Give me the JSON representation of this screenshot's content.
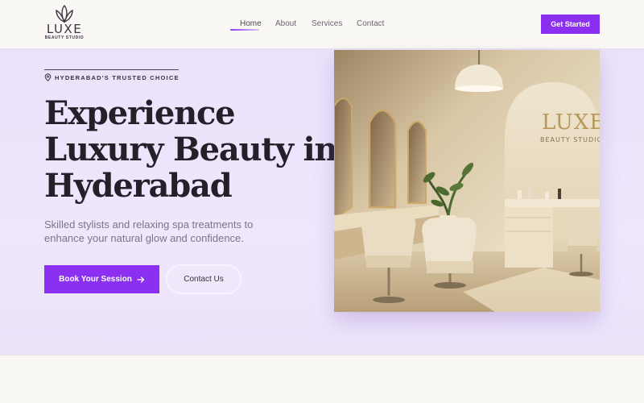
{
  "header": {
    "logo_word": "LUXE",
    "logo_sub": "BEAUTY STUDIO",
    "nav": [
      {
        "label": "Home",
        "active": true
      },
      {
        "label": "About"
      },
      {
        "label": "Services"
      },
      {
        "label": "Contact"
      }
    ],
    "cta_label": "Get Started"
  },
  "hero": {
    "eyebrow": "HYDERABAD'S TRUSTED CHOICE",
    "headline_lines": [
      "Experience",
      "Luxury Beauty in",
      "Hyderabad"
    ],
    "subtext": "Skilled stylists and relaxing spa treatments to enhance your natural glow and confidence.",
    "primary_button": "Book Your Session",
    "secondary_button": "Contact Us",
    "image": {
      "sign_word": "LUXE",
      "sign_sub": "BEAUTY STUDIO"
    }
  },
  "colors": {
    "accent": "#8b2ff0",
    "hero_bg": "#ede4fc",
    "text_dark": "#24202a"
  },
  "icons": [
    "lotus-logo-icon",
    "location-pin-icon",
    "arrow-right-icon"
  ]
}
